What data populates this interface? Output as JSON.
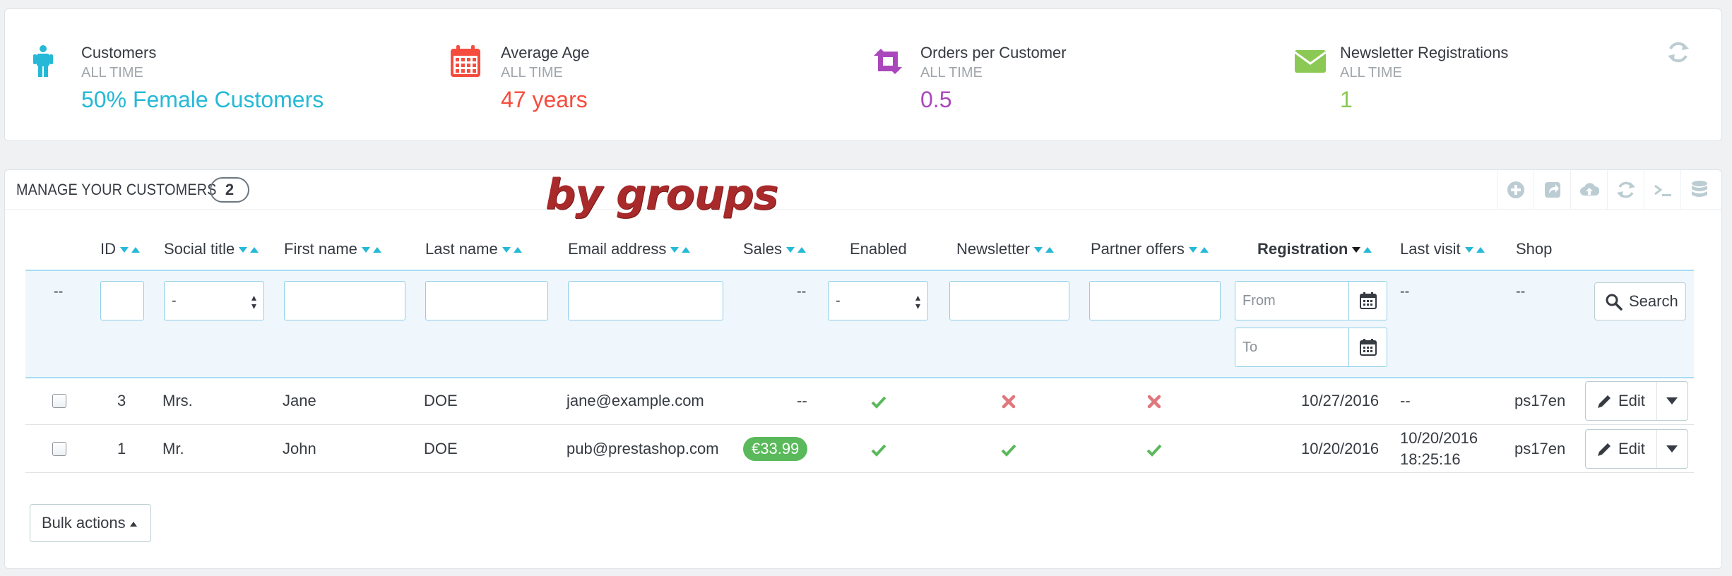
{
  "kpis": [
    {
      "title": "Customers",
      "sub": "ALL TIME",
      "value": "50% Female Customers",
      "color": "#25b9d7",
      "icon": "person-icon"
    },
    {
      "title": "Average Age",
      "sub": "ALL TIME",
      "value": "47 years",
      "color": "#f54c3e",
      "icon": "calendar-icon"
    },
    {
      "title": "Orders per Customer",
      "sub": "ALL TIME",
      "value": "0.5",
      "color": "#ab47bc",
      "icon": "retweet-icon"
    },
    {
      "title": "Newsletter Registrations",
      "sub": "ALL TIME",
      "value": "1",
      "color": "#8bc954",
      "icon": "envelope-icon"
    }
  ],
  "panel": {
    "title": "Manage your customers",
    "count": "2",
    "overlay": "by groups"
  },
  "columns": {
    "id": "ID",
    "social_title": "Social title",
    "first_name": "First name",
    "last_name": "Last name",
    "email": "Email address",
    "sales": "Sales",
    "enabled": "Enabled",
    "newsletter": "Newsletter",
    "partner": "Partner offers",
    "registration": "Registration",
    "last_visit": "Last visit",
    "shop": "Shop"
  },
  "filters": {
    "dash": "--",
    "select_value": "-",
    "from_placeholder": "From",
    "to_placeholder": "To",
    "search_label": "Search"
  },
  "rows": [
    {
      "id": "3",
      "social_title": "Mrs.",
      "first_name": "Jane",
      "last_name": "DOE",
      "email": "jane@example.com",
      "sales": "--",
      "enabled": true,
      "newsletter": false,
      "partner": false,
      "registration": "10/27/2016",
      "last_visit": "--",
      "last_visit_time": "",
      "shop": "ps17en",
      "edit": "Edit"
    },
    {
      "id": "1",
      "social_title": "Mr.",
      "first_name": "John",
      "last_name": "DOE",
      "email": "pub@prestashop.com",
      "sales": "€33.99",
      "enabled": true,
      "newsletter": true,
      "partner": true,
      "registration": "10/20/2016",
      "last_visit": "10/20/2016",
      "last_visit_time": "18:25:16",
      "shop": "ps17en",
      "edit": "Edit"
    }
  ],
  "bulk_actions": "Bulk actions",
  "colors": {
    "check": "#5ab95b",
    "cross": "#e0777c",
    "accent": "#25b9d7"
  }
}
